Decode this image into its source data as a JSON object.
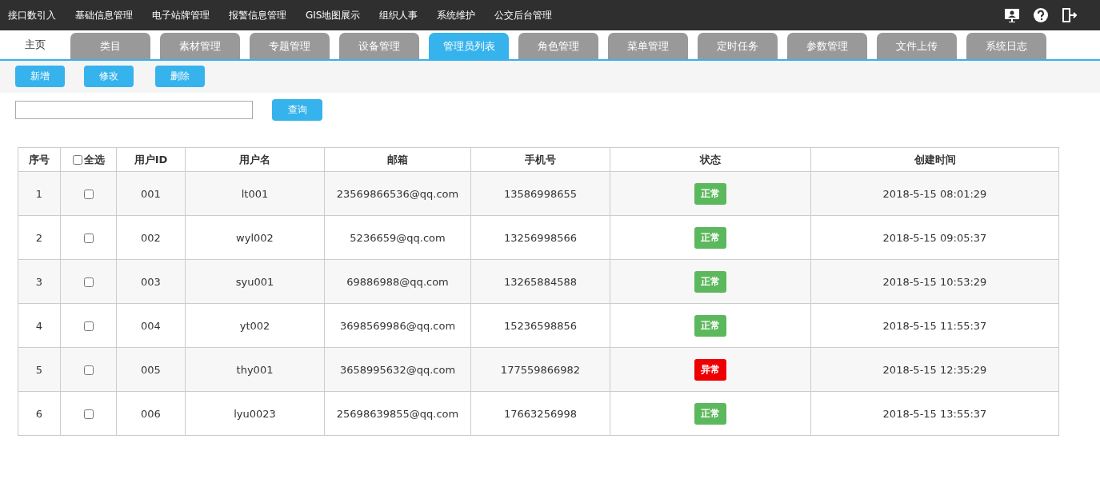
{
  "top_menu": [
    "接口数引入",
    "基础信息管理",
    "电子站牌管理",
    "报警信息管理",
    "GIS地图展示",
    "组织人事",
    "系统维护",
    "公交后台管理"
  ],
  "tabs": [
    {
      "label": "主页",
      "kind": "home",
      "selected": false
    },
    {
      "label": "类目",
      "kind": "tab",
      "selected": false
    },
    {
      "label": "素材管理",
      "kind": "tab",
      "selected": false
    },
    {
      "label": "专题管理",
      "kind": "tab",
      "selected": false
    },
    {
      "label": "设备管理",
      "kind": "tab",
      "selected": false
    },
    {
      "label": "管理员列表",
      "kind": "tab",
      "selected": true
    },
    {
      "label": "角色管理",
      "kind": "tab",
      "selected": false
    },
    {
      "label": "菜单管理",
      "kind": "tab",
      "selected": false
    },
    {
      "label": "定时任务",
      "kind": "tab",
      "selected": false
    },
    {
      "label": "参数管理",
      "kind": "tab",
      "selected": false
    },
    {
      "label": "文件上传",
      "kind": "tab",
      "selected": false
    },
    {
      "label": "系统日志",
      "kind": "tab",
      "selected": false
    }
  ],
  "actions": [
    "新增",
    "修改",
    "删除"
  ],
  "search": {
    "button": "查询"
  },
  "table": {
    "columns": [
      "序号",
      "全选",
      "用户ID",
      "用户名",
      "邮箱",
      "手机号",
      "状态",
      "创建时间"
    ],
    "select_all_checked": false,
    "rows": [
      {
        "index": "1",
        "checked": false,
        "id": "001",
        "name": "lt001",
        "email": "23569866536@qq.com",
        "phone": "13586998655",
        "status": "正常",
        "color": "#5cb85c",
        "created": "2018-5-15 08:01:29"
      },
      {
        "index": "2",
        "checked": false,
        "id": "002",
        "name": "wyl002",
        "email": "5236659@qq.com",
        "phone": "13256998566",
        "status": "正常",
        "color": "#5cb85c",
        "created": "2018-5-15 09:05:37"
      },
      {
        "index": "3",
        "checked": false,
        "id": "003",
        "name": "syu001",
        "email": "69886988@qq.com",
        "phone": "13265884588",
        "status": "正常",
        "color": "#5cb85c",
        "created": "2018-5-15 10:53:29"
      },
      {
        "index": "4",
        "checked": false,
        "id": "004",
        "name": "yt002",
        "email": "3698569986@qq.com",
        "phone": "15236598856",
        "status": "正常",
        "color": "#5cb85c",
        "created": "2018-5-15 11:55:37"
      },
      {
        "index": "5",
        "checked": false,
        "id": "005",
        "name": "thy001",
        "email": "3658995632@qq.com",
        "phone": "177559866982",
        "status": "异常",
        "color": "#ee0000",
        "created": "2018-5-15 12:35:29"
      },
      {
        "index": "6",
        "checked": false,
        "id": "006",
        "name": "lyu0023",
        "email": "25698639855@qq.com",
        "phone": "17663256998",
        "status": "正常",
        "color": "#5cb85c",
        "created": "2018-5-15 13:55:37"
      }
    ]
  }
}
